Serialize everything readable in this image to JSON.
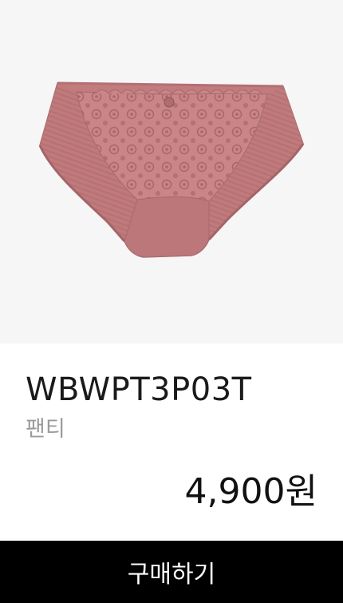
{
  "product": {
    "code": "WBWPT3P03T",
    "category": "팬티",
    "price": "4,900원",
    "image_icon": "panty-lace-product-image",
    "color": "#c27c7e"
  },
  "actions": {
    "buy_label": "구매하기"
  }
}
